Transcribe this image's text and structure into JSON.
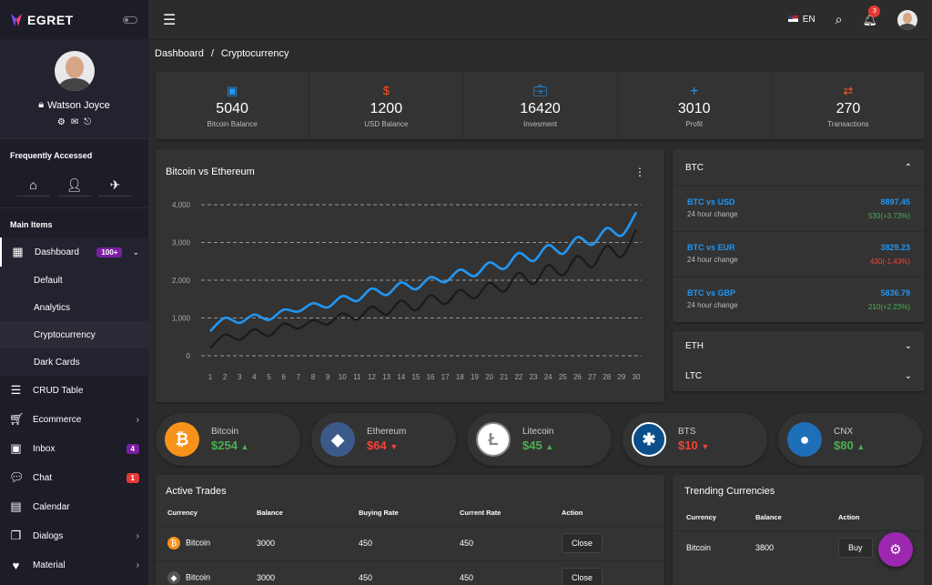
{
  "brand": {
    "name": "EGRET"
  },
  "user": {
    "name": "Watson Joyce"
  },
  "sidebar": {
    "frequently_title": "Frequently Accessed",
    "main_title": "Main Items",
    "dashboard": {
      "label": "Dashboard",
      "badge": "100+",
      "badge_color": "#7b1fa2"
    },
    "sub": [
      {
        "label": "Default"
      },
      {
        "label": "Analytics"
      },
      {
        "label": "Cryptocurrency"
      },
      {
        "label": "Dark Cards"
      }
    ],
    "items": [
      {
        "label": "CRUD Table",
        "icon": "list-icon"
      },
      {
        "label": "Ecommerce",
        "icon": "cart-icon"
      },
      {
        "label": "Inbox",
        "icon": "inbox-icon",
        "badge": "4",
        "badge_color": "#7b1fa2"
      },
      {
        "label": "Chat",
        "icon": "chat-icon",
        "badge": "1",
        "badge_color": "#e53935"
      },
      {
        "label": "Calendar",
        "icon": "calendar-icon"
      },
      {
        "label": "Dialogs",
        "icon": "dialogs-icon"
      },
      {
        "label": "Material",
        "icon": "heart-icon"
      }
    ]
  },
  "topbar": {
    "lang": "EN",
    "notifications": "3"
  },
  "breadcrumb": {
    "root": "Dashboard",
    "sep": "/",
    "current": "Cryptocurrency"
  },
  "stats": [
    {
      "icon": "wallet-icon",
      "value": "5040",
      "label": "Bitcoin Balance",
      "color": "#2196f3"
    },
    {
      "icon": "dollar-icon",
      "value": "1200",
      "label": "USD Balance",
      "color": "#ff5722"
    },
    {
      "icon": "briefcase-icon",
      "value": "16420",
      "label": "Invesment",
      "color": "#2196f3"
    },
    {
      "icon": "plus-icon",
      "value": "3010",
      "label": "Profit",
      "color": "#2196f3"
    },
    {
      "icon": "transfer-icon",
      "value": "270",
      "label": "Transactions",
      "color": "#ff5722"
    }
  ],
  "chart_title": "Bitcoin vs Ethereum",
  "chart_data": {
    "type": "line",
    "title": "Bitcoin vs Ethereum",
    "x": [
      1,
      2,
      3,
      4,
      5,
      6,
      7,
      8,
      9,
      10,
      11,
      12,
      13,
      14,
      15,
      16,
      17,
      18,
      19,
      20,
      21,
      22,
      23,
      24,
      25,
      26,
      27,
      28,
      29,
      30
    ],
    "yticks": [
      "0",
      "1,000",
      "2,000",
      "3,000",
      "4,000"
    ],
    "ylim": [
      0,
      4000
    ],
    "grid": true,
    "series": [
      {
        "values": [
          650,
          1000,
          870,
          1090,
          950,
          1220,
          1170,
          1390,
          1280,
          1580,
          1450,
          1780,
          1610,
          1940,
          1760,
          2080,
          1950,
          2280,
          2110,
          2470,
          2300,
          2720,
          2510,
          2930,
          2700,
          3140,
          2940,
          3380,
          3180,
          3800
        ],
        "color": "#2196f3"
      },
      {
        "values": [
          200,
          560,
          420,
          700,
          520,
          850,
          720,
          940,
          830,
          1120,
          960,
          1300,
          1090,
          1460,
          1200,
          1600,
          1370,
          1740,
          1520,
          1930,
          1700,
          2200,
          1900,
          2400,
          2130,
          2640,
          2350,
          2910,
          2620,
          3350
        ],
        "color": "#1a1a1a"
      }
    ]
  },
  "btc": {
    "title": "BTC",
    "pairs": [
      {
        "name": "BTC vs USD",
        "sub": "24 hour change",
        "price": "8897.45",
        "change": "530(+3.73%)",
        "dir": "pos"
      },
      {
        "name": "BTC vs EUR",
        "sub": "24 hour change",
        "price": "3829.23",
        "change": "430(-1.43%)",
        "dir": "neg"
      },
      {
        "name": "BTC vs GBP",
        "sub": "24 hour change",
        "price": "5836.79",
        "change": "210(+2.23%)",
        "dir": "pos"
      }
    ]
  },
  "eth": {
    "title": "ETH"
  },
  "ltc": {
    "title": "LTC"
  },
  "coins": [
    {
      "name": "Bitcoin",
      "value": "$254",
      "dir": "up",
      "color": "#4caf50",
      "bg": "#f7931a",
      "glyph": "₿"
    },
    {
      "name": "Ethereum",
      "value": "$64",
      "dir": "down",
      "color": "#f44336",
      "bg": "#3c5a89",
      "glyph": "◆"
    },
    {
      "name": "Litecoin",
      "value": "$45",
      "dir": "up",
      "color": "#4caf50",
      "bg": "#ffffff",
      "glyph": "Ł"
    },
    {
      "name": "BTS",
      "value": "$10",
      "dir": "down",
      "color": "#f44336",
      "bg": "#0a4f8a",
      "glyph": "✱"
    },
    {
      "name": "CNX",
      "value": "$80",
      "dir": "up",
      "color": "#4caf50",
      "bg": "#1e6fb8",
      "glyph": "●"
    }
  ],
  "trades": {
    "title": "Active Trades",
    "headers": [
      "Currency",
      "Balance",
      "Buying Rate",
      "Current Rate",
      "Action"
    ],
    "rows": [
      {
        "currency": "Bitcoin",
        "balance": "3000",
        "buying": "450",
        "current": "450",
        "action": "Close"
      },
      {
        "currency": "Bitcoin",
        "balance": "3000",
        "buying": "450",
        "current": "450",
        "action": "Close"
      }
    ]
  },
  "trending": {
    "title": "Trending Currencies",
    "headers": [
      "Currency",
      "Balance",
      "Action"
    ],
    "rows": [
      {
        "currency": "Bitcoin",
        "balance": "3800",
        "action": "Buy"
      }
    ]
  }
}
